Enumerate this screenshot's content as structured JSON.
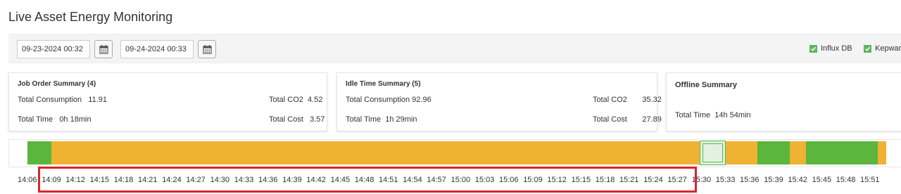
{
  "page": {
    "title": "Live Asset Energy Monitoring"
  },
  "filters": {
    "start_date": "09-23-2024 00:32",
    "end_date": "09-24-2024 00:33",
    "sources": [
      {
        "label": "Influx DB",
        "checked": true
      },
      {
        "label": "Kepware",
        "checked": true
      }
    ]
  },
  "cards": {
    "job_order": {
      "title": "Job Order Summary (4)",
      "total_consumption_label": "Total Consumption",
      "total_consumption": "11.91",
      "total_co2_label": "Total CO2",
      "total_co2": "4.52",
      "total_time_label": "Total Time",
      "total_time": "0h 18min",
      "total_cost_label": "Total Cost",
      "total_cost": "3.57"
    },
    "idle_time": {
      "title": "Idle Time Summary (5)",
      "total_consumption_label": "Total Consumption",
      "total_consumption": "92.96",
      "total_co2_label": "Total CO2",
      "total_co2": "35.32",
      "total_time_label": "Total Time",
      "total_time": "1h 29min",
      "total_cost_label": "Total Cost",
      "total_cost": "27.89"
    },
    "offline": {
      "title": "Offline Summary",
      "total_time_label": "Total Time",
      "total_time": "14h 54min"
    }
  },
  "timeline": {
    "colors": {
      "active": "#5ab63d",
      "idle": "#f0b232",
      "selected_fill": "#e3f2e0"
    },
    "segments": [
      {
        "state": "active",
        "start": "14:06",
        "end": "14:09"
      },
      {
        "state": "idle",
        "start": "14:09",
        "end": "15:30"
      },
      {
        "state": "selected",
        "start": "15:30",
        "end": "15:33"
      },
      {
        "state": "idle",
        "start": "15:33",
        "end": "15:37"
      },
      {
        "state": "active",
        "start": "15:37",
        "end": "15:41"
      },
      {
        "state": "idle",
        "start": "15:41",
        "end": "15:43"
      },
      {
        "state": "active",
        "start": "15:43",
        "end": "15:52"
      },
      {
        "state": "idle",
        "start": "15:52",
        "end": "15:53"
      }
    ],
    "ticks": [
      "14:06",
      "14:09",
      "14:12",
      "14:15",
      "14:18",
      "14:21",
      "14:24",
      "14:27",
      "14:30",
      "14:33",
      "14:36",
      "14:39",
      "14:42",
      "14:45",
      "14:48",
      "14:51",
      "14:54",
      "14:57",
      "15:00",
      "15:03",
      "15:06",
      "15:09",
      "15:12",
      "15:15",
      "15:18",
      "15:21",
      "15:24",
      "15:27",
      "15:30",
      "15:33",
      "15:36",
      "15:39",
      "15:42",
      "15:45",
      "15:48",
      "15:51"
    ],
    "highlight": {
      "color": "#d9232d",
      "from": "14:09",
      "to": "15:27"
    }
  }
}
